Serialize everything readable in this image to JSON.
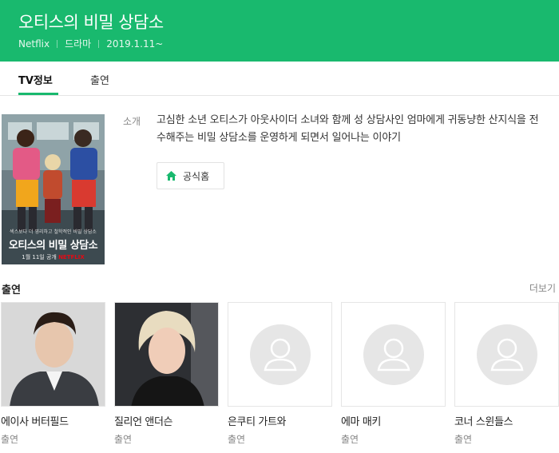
{
  "header": {
    "title": "오티스의 비밀 상담소",
    "network": "Netflix",
    "genre": "드라마",
    "air_date": "2019.1.11~"
  },
  "tabs": [
    {
      "label": "TV정보",
      "active": true
    },
    {
      "label": "출연",
      "active": false
    }
  ],
  "poster": {
    "title": "오티스의 비밀 상담소",
    "tagline": "섹스보다 더 영리하고 철학적인 비밀 상담소",
    "bottom": "1월 11일 공개",
    "brand": "NETFLIX"
  },
  "intro": {
    "label": "소개",
    "text": "고심한 소년 오티스가 아웃사이더 소녀와 함께 성 상담사인 엄마에게 귀동냥한 산지식을 전수해주는 비밀 상담소를 운영하게 되면서 일어나는 이야기"
  },
  "home_button": {
    "label": "공식홈",
    "icon": "home-icon"
  },
  "cast_section": {
    "title": "출연",
    "more": "더보기",
    "members": [
      {
        "name": "에이사 버터필드",
        "role": "출연",
        "photo": "person-photo"
      },
      {
        "name": "질리언 앤더슨",
        "role": "출연",
        "photo": "person-photo"
      },
      {
        "name": "은쿠티 가트와",
        "role": "출연",
        "photo": "placeholder"
      },
      {
        "name": "에마 매키",
        "role": "출연",
        "photo": "placeholder"
      },
      {
        "name": "코너 스윈들스",
        "role": "출연",
        "photo": "placeholder"
      }
    ]
  },
  "colors": {
    "brand_green": "#19b96e",
    "netflix_red": "#e50914"
  }
}
